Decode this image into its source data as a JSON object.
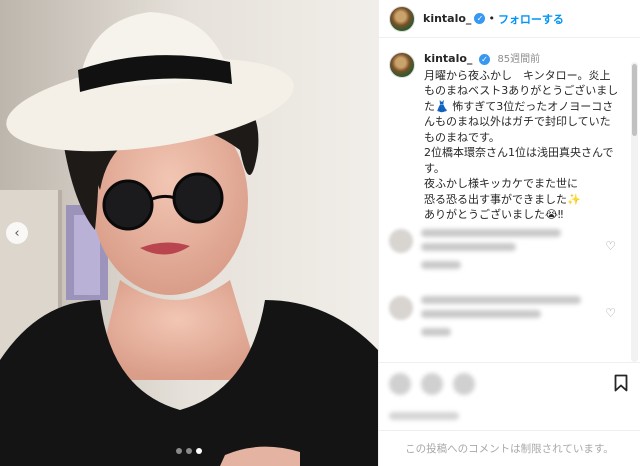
{
  "post": {
    "username": "kintalo_",
    "separator": "•",
    "follow_label": "フォローする",
    "time_ago": "85週間前",
    "caption_lines": [
      "月曜から夜ふかし　キンタロー。炎上",
      "ものまねベスト3ありがとうございまし",
      "た👗 怖すぎて3位だったオノヨーコさ",
      "んものまね以外はガチで封印していた",
      "ものまねです。",
      "2位橋本環奈さん1位は浅田真央さんで",
      "す。",
      "夜ふかし様キッカケでまた世に",
      "恐る恐る出す事ができました✨",
      "ありがとうございました😭‼"
    ],
    "comments_disabled_text": "この投稿へのコメントは制限されています。"
  },
  "carousel": {
    "prev_icon": "‹",
    "dot_count": 3,
    "active_index": 2
  },
  "colors": {
    "link_blue": "#0095f6",
    "verified_blue": "#3897f0",
    "muted_gray": "#8e8e8e"
  }
}
